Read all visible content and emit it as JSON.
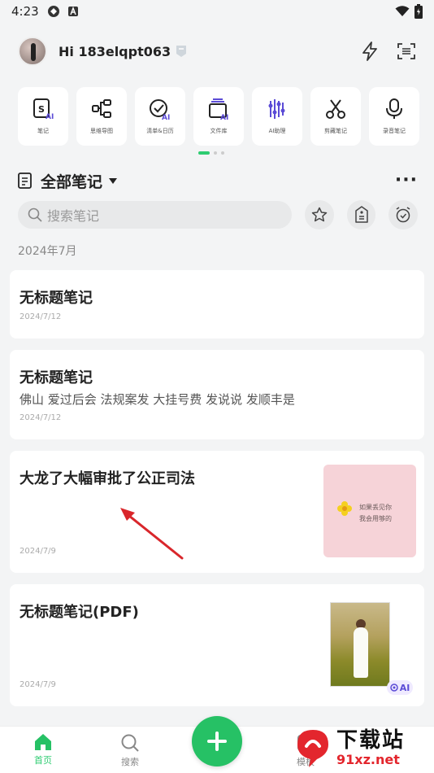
{
  "status_bar": {
    "time": "4:23"
  },
  "header": {
    "greeting": "Hi 183elqpt063"
  },
  "tools": [
    {
      "label": "笔记",
      "icon": "note-ai-icon"
    },
    {
      "label": "思维导图",
      "icon": "mindmap-icon"
    },
    {
      "label": "清单&日历",
      "icon": "checklist-ai-icon"
    },
    {
      "label": "文件库",
      "icon": "file-library-ai-icon"
    },
    {
      "label": "AI助理",
      "icon": "ai-assistant-icon"
    },
    {
      "label": "剪藏笔记",
      "icon": "scissors-icon"
    },
    {
      "label": "录音笔记",
      "icon": "microphone-icon"
    }
  ],
  "pager": {
    "pages": 3,
    "active": 0
  },
  "section": {
    "title": "全部笔记",
    "more": "···"
  },
  "search": {
    "placeholder": "搜索笔记"
  },
  "month_label": "2024年7月",
  "notes": [
    {
      "title": "无标题笔记",
      "body": "",
      "date": "2024/7/12"
    },
    {
      "title": "无标题笔记",
      "body": "佛山 爱过后会 法规案发 大挂号费 发说说 发顺丰是",
      "date": "2024/7/12"
    },
    {
      "title": "大龙了大幅审批了公正司法",
      "body": "",
      "date": "2024/7/9",
      "thumb_text_1": "如果丢见你",
      "thumb_text_2": "我会用够的"
    },
    {
      "title": "无标题笔记(PDF)",
      "body": "",
      "date": "2024/7/9",
      "ai_tag": "AI"
    }
  ],
  "bottom_nav": {
    "home": "首页",
    "search": "搜索",
    "templates": "模板"
  },
  "watermark": {
    "title": "下载站",
    "url": "91xz.net"
  },
  "colors": {
    "accent": "#26c165",
    "ai_purple": "#5b4bd6",
    "arrow_red": "#d9262b"
  }
}
